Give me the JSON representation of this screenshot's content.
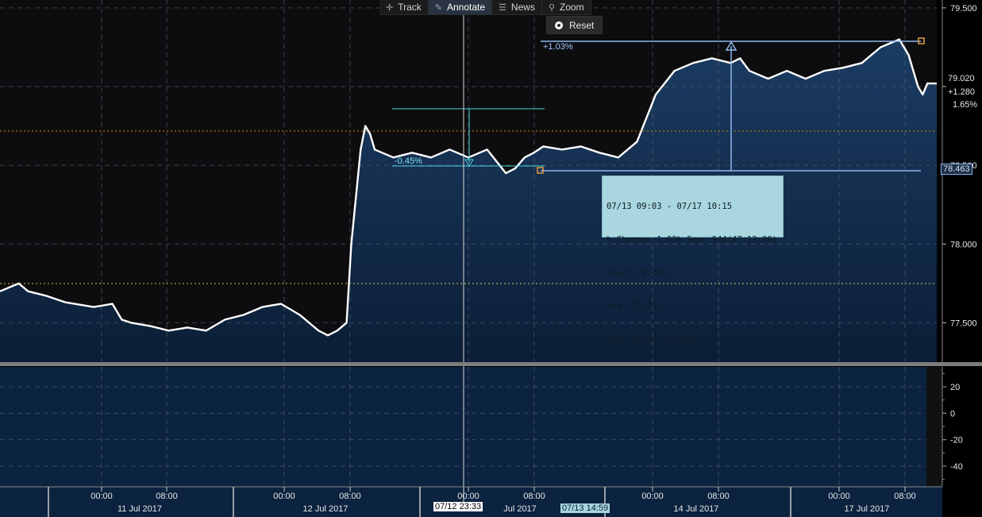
{
  "toolbar": {
    "track_label": "Track",
    "annotate_label": "Annotate",
    "news_label": "News",
    "zoom_label": "Zoom",
    "reset_label": "Reset"
  },
  "tooltip": {
    "line1": "07/13 09:03 - 07/17 10:15",
    "line2": "% Change +1.03% Span 944(47:12:00)",
    "line3": "Start 78.450",
    "line4": "End  79.255",
    "line5": "Span 944(47:12:00)"
  },
  "annotations": {
    "measure_pct": "+1.03%",
    "small_measure_pct": "-0.45%",
    "last_price": "79.020",
    "last_change": "+1.280",
    "last_change_pct": "1.65%",
    "marker_price": "78.463",
    "cursor_date_1": "07/12 23:33",
    "cursor_date_2": "07/13 14:59"
  },
  "colors": {
    "line": "#ffffff",
    "area_top": "#1c3c63",
    "area_bottom": "#0b1e36",
    "grid": "#5a6777",
    "measure": "#8fb6ef",
    "cyan": "#4fd1d9",
    "orange_dotted": "#d97d16",
    "yellow_dotted": "#d6c84a"
  },
  "chart_data": [
    {
      "type": "area",
      "title": "",
      "ylim": [
        77.25,
        79.55
      ],
      "y_ticks": [
        77.5,
        78.0,
        78.5,
        79.0,
        79.5
      ],
      "y_tick_labels": [
        "77.500",
        "78.000",
        "78.500",
        "",
        "79.500"
      ],
      "x_tick_labels": [
        "00:00",
        "08:00",
        "00:00",
        "08:00",
        "00:00",
        "08:00",
        "00:00",
        "08:00",
        "00:00",
        "08:00"
      ],
      "x_day_labels": [
        "11 Jul 2017",
        "12 Jul 2017",
        "Jul 2017",
        "14 Jul 2017",
        "17 Jul 2017"
      ],
      "grid": true,
      "series": [
        {
          "x": [
            0,
            0.02,
            0.03,
            0.05,
            0.07,
            0.1,
            0.12,
            0.13,
            0.14,
            0.16,
            0.18,
            0.2,
            0.22,
            0.24,
            0.26,
            0.28,
            0.3,
            0.32,
            0.34,
            0.35,
            0.36,
            0.37,
            0.375,
            0.38,
            0.385,
            0.39,
            0.395,
            0.4,
            0.42,
            0.44,
            0.46,
            0.48,
            0.5,
            0.52,
            0.54,
            0.55,
            0.56,
            0.57,
            0.58,
            0.6,
            0.62,
            0.64,
            0.66,
            0.68,
            0.7,
            0.72,
            0.74,
            0.76,
            0.78,
            0.79,
            0.8,
            0.82,
            0.84,
            0.86,
            0.88,
            0.9,
            0.92,
            0.94,
            0.96,
            0.97,
            0.98,
            0.985,
            0.99,
            1.0
          ],
          "values": [
            77.7,
            77.75,
            77.7,
            77.67,
            77.63,
            77.6,
            77.62,
            77.52,
            77.5,
            77.48,
            77.45,
            77.47,
            77.45,
            77.52,
            77.55,
            77.6,
            77.62,
            77.55,
            77.45,
            77.42,
            77.45,
            77.5,
            78.0,
            78.3,
            78.6,
            78.75,
            78.7,
            78.6,
            78.55,
            78.58,
            78.55,
            78.6,
            78.55,
            78.6,
            78.45,
            78.48,
            78.55,
            78.58,
            78.62,
            78.6,
            78.62,
            78.58,
            78.55,
            78.65,
            78.95,
            79.1,
            79.15,
            79.18,
            79.15,
            79.18,
            79.1,
            79.05,
            79.1,
            79.05,
            79.1,
            79.12,
            79.15,
            79.25,
            79.3,
            79.2,
            79.0,
            78.95,
            79.02,
            79.02
          ]
        }
      ]
    },
    {
      "type": "line",
      "title": "",
      "ylim": [
        -55,
        35
      ],
      "y_ticks": [
        20,
        0,
        -20,
        -40
      ],
      "y_tick_labels": [
        "20",
        "0",
        "-20",
        "-40"
      ],
      "grid": true,
      "series": []
    }
  ]
}
